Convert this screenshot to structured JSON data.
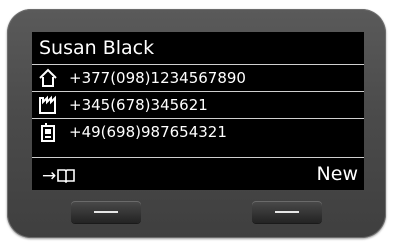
{
  "contact": {
    "name": "Susan Black",
    "entries": [
      {
        "type": "home-icon",
        "number": "+377(098)1234567890"
      },
      {
        "type": "office-icon",
        "number": "+345(678)345621"
      },
      {
        "type": "mobile-icon",
        "number": "+49(698)987654321"
      }
    ]
  },
  "softkeys": {
    "left_arrow": "→",
    "left_icon": "phonebook-icon",
    "right_label": "New"
  },
  "colors": {
    "screen": "#000000",
    "text": "#ffffff",
    "bezel": "#4b4b4b",
    "separator": "#cfcfcf"
  }
}
